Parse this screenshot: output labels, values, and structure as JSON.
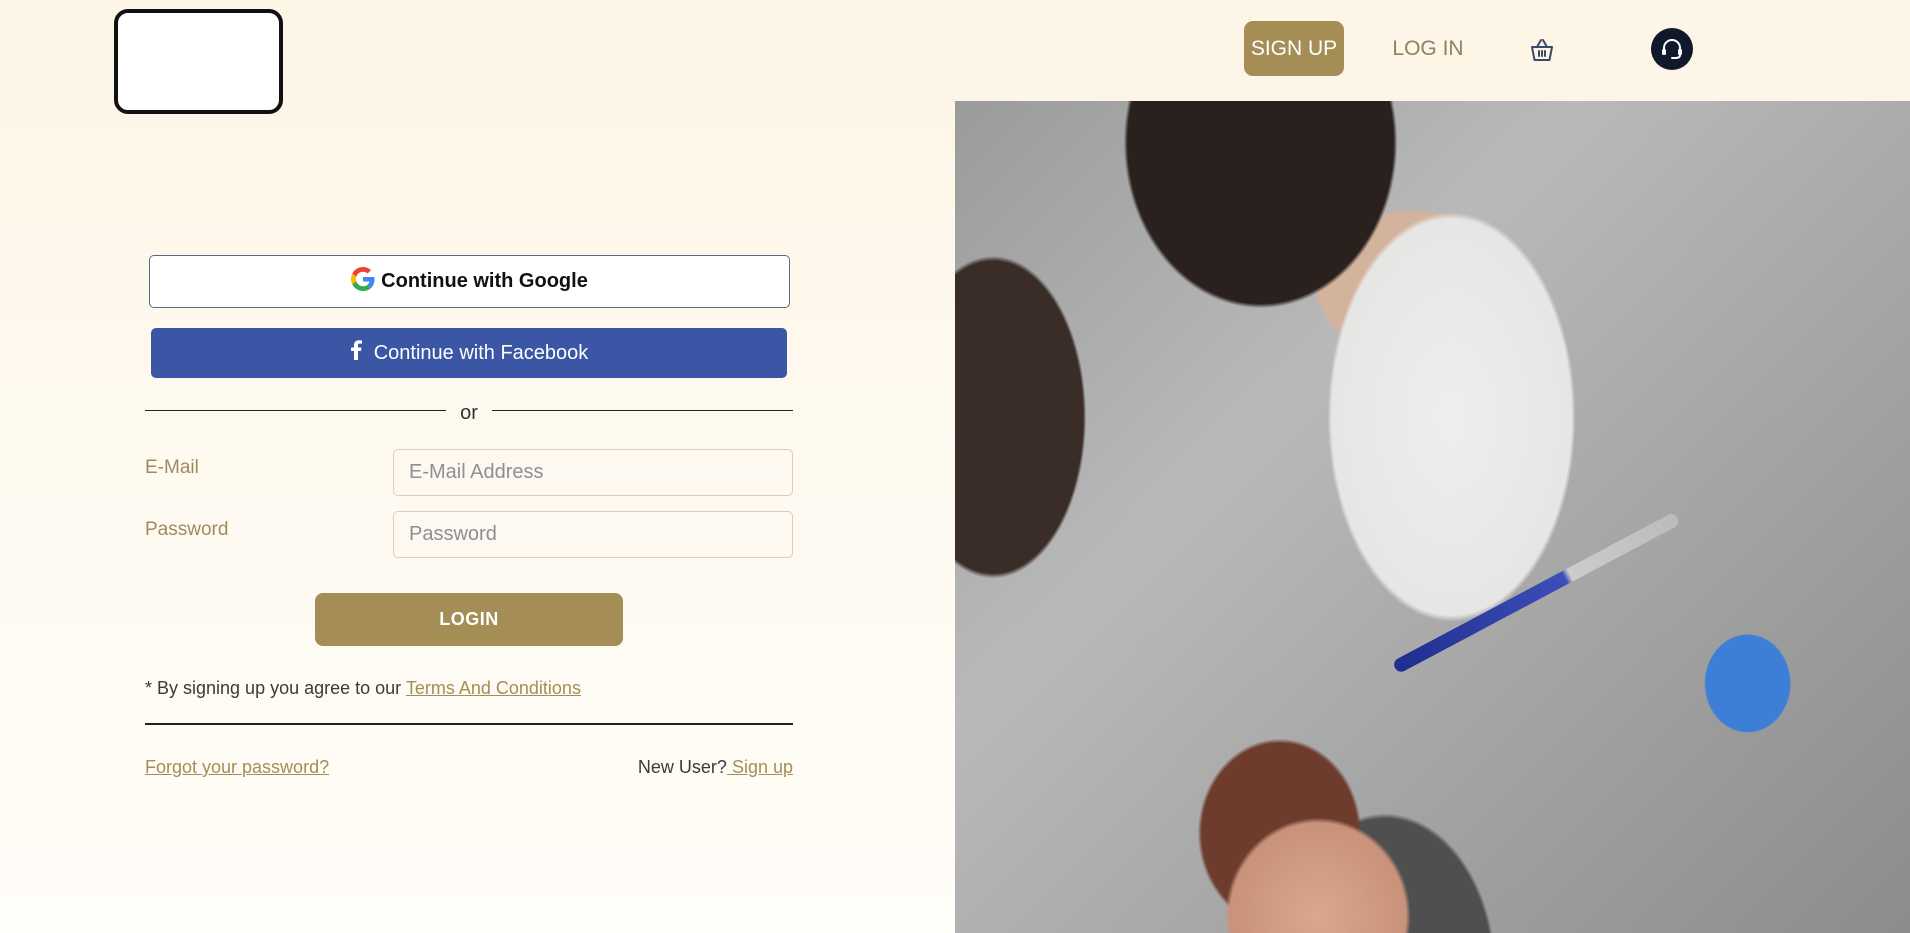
{
  "header": {
    "signup_label": "SIGN UP",
    "login_label": "LOG IN",
    "cart_icon": "basket-icon",
    "support_icon": "headset-icon",
    "accent_color": "#a48e55"
  },
  "auth": {
    "google_label": "Continue with Google",
    "facebook_label": "Continue with Facebook",
    "divider_text": "or",
    "email_label": "E-Mail",
    "email_placeholder": "E-Mail Address",
    "email_value": "",
    "password_label": "Password",
    "password_placeholder": "Password",
    "password_value": "",
    "login_button": "LOGIN",
    "terms_prefix": "* By signing up you agree to our",
    "terms_link": "Terms And Conditions",
    "forgot_link": "Forgot your password?",
    "new_user_text": "New User?",
    "signup_link": " Sign up"
  },
  "colors": {
    "facebook": "#3b56a4",
    "link": "#a48e55",
    "support_bg": "#10182b"
  }
}
